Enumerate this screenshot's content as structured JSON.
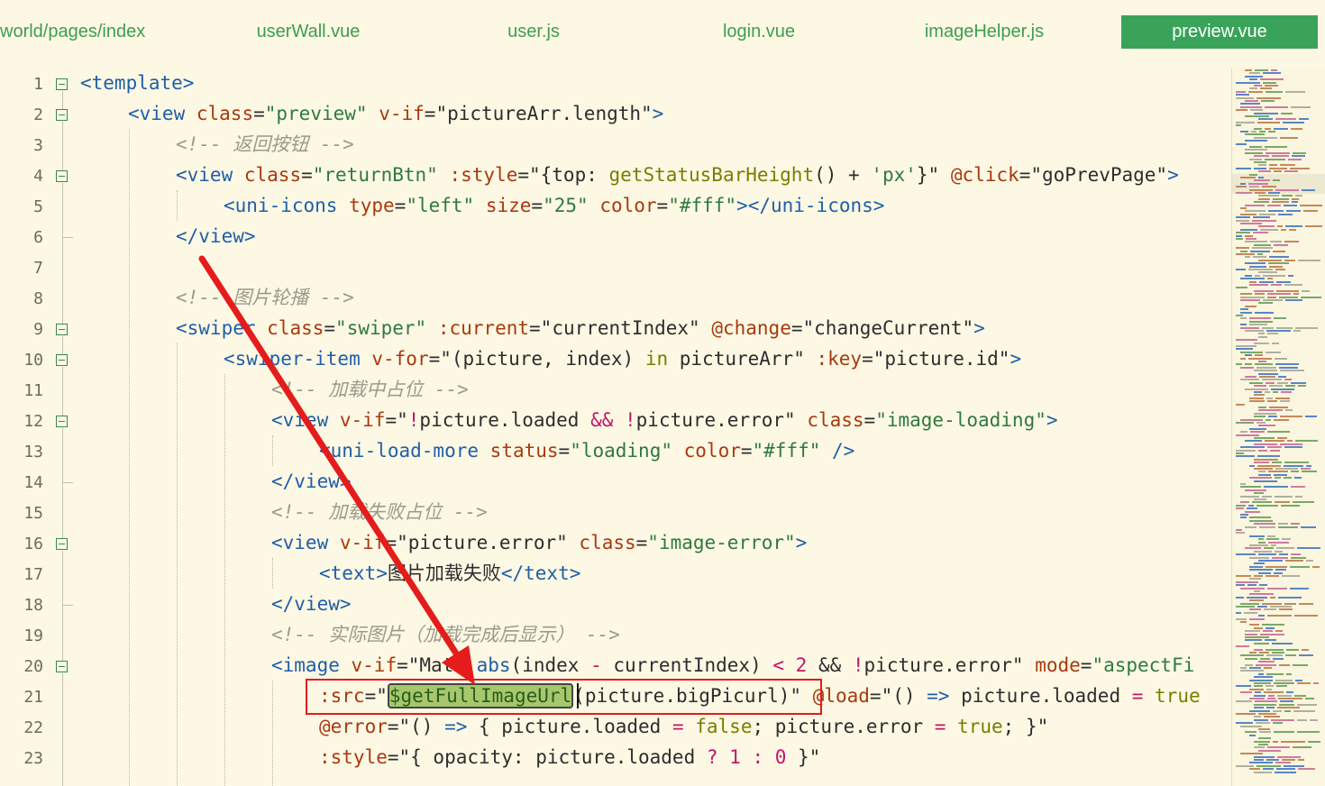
{
  "tabs": [
    {
      "label": "world/pages/index",
      "active": false
    },
    {
      "label": "userWall.vue",
      "active": false
    },
    {
      "label": "user.js",
      "active": false
    },
    {
      "label": "login.vue",
      "active": false
    },
    {
      "label": "imageHelper.js",
      "active": false
    },
    {
      "label": "preview.vue",
      "active": true
    }
  ],
  "line_numbers": [
    "1",
    "2",
    "3",
    "4",
    "5",
    "6",
    "7",
    "8",
    "9",
    "10",
    "11",
    "12",
    "13",
    "14",
    "15",
    "16",
    "17",
    "18",
    "19",
    "20",
    "21",
    "22",
    "23"
  ],
  "code": {
    "l1": {
      "t1": "<template>"
    },
    "l2": {
      "t1": "<view",
      "a1": "class",
      "e1": "=",
      "s1": "\"preview\"",
      "a2": "v-if",
      "e2": "=",
      "s2": "\"pictureArr.length\"",
      "t2": ">"
    },
    "l3": {
      "c1": "<!-- 返回按钮 -->"
    },
    "l4": {
      "t1": "<view",
      "a1": "class",
      "e1": "=",
      "s1": "\"returnBtn\"",
      "a2": ":style",
      "e2": "=",
      "s2": "\"{top: ",
      "f1": "getStatusBarHeight",
      "p1": "() + ",
      "s3": "'px'",
      "s4": "}\"",
      "a3": "@click",
      "e3": "=",
      "s5": "\"goPrevPage\"",
      "t2": ">"
    },
    "l5": {
      "t1": "<uni-icons",
      "a1": "type",
      "e1": "=",
      "s1": "\"left\"",
      "a2": "size",
      "e2": "=",
      "s2": "\"25\"",
      "a3": "color",
      "e3": "=",
      "s3": "\"#fff\"",
      "t2": "></uni-icons>"
    },
    "l6": {
      "t1": "</view>"
    },
    "l8": {
      "c1": "<!-- 图片轮播 -->"
    },
    "l9": {
      "t1": "<swiper",
      "a1": "class",
      "e1": "=",
      "s1": "\"swiper\"",
      "a2": ":current",
      "e2": "=",
      "s2": "\"currentIndex\"",
      "a3": "@change",
      "e3": "=",
      "s3": "\"changeCurrent\"",
      "t2": ">"
    },
    "l10": {
      "t1": "<swiper-item",
      "a1": "v-for",
      "e1": "=",
      "s1": "\"(picture, index) ",
      "k1": "in",
      "s2": " pictureArr\"",
      "a2": ":key",
      "e2": "=",
      "s3": "\"picture.id\"",
      "t2": ">"
    },
    "l11": {
      "c1": "<!-- 加载中占位 -->"
    },
    "l12": {
      "t1": "<view",
      "a1": "v-if",
      "e1": "=",
      "s1": "\"",
      "n1": "!",
      "p1": "picture.loaded ",
      "n2": "&& !",
      "p2": "picture.error\"",
      "a2": "class",
      "e2": "=",
      "s2": "\"image-loading\"",
      "t2": ">"
    },
    "l13": {
      "t1": "<uni-load-more",
      "a1": "status",
      "e1": "=",
      "s1": "\"loading\"",
      "a2": "color",
      "e2": "=",
      "s2": "\"#fff\"",
      "t2": "/>"
    },
    "l14": {
      "t1": "</view>"
    },
    "l15": {
      "c1": "<!-- 加载失败占位 -->"
    },
    "l16": {
      "t1": "<view",
      "a1": "v-if",
      "e1": "=",
      "s1": "\"picture.error\"",
      "a2": "class",
      "e2": "=",
      "s2": "\"image-error\"",
      "t2": ">"
    },
    "l17": {
      "t1": "<text>",
      "p1": "图片加载失败",
      "t2": "</text>"
    },
    "l18": {
      "t1": "</view>"
    },
    "l19": {
      "c1": "<!-- 实际图片（加载完成后显示） -->"
    },
    "l20": {
      "t1": "<image",
      "a1": "v-if",
      "e1": "=",
      "s1": "\"Math.",
      "f1": "abs",
      "p1": "(index ",
      "n1": "-",
      "p2": " currentIndex) ",
      "n2": "< 2",
      "p3": " && ",
      "n3": "!",
      "p4": "picture.error\"",
      "a2": "mode",
      "e2": "=",
      "s2": "\"aspectFi"
    },
    "l21": {
      "a1": ":src",
      "p1": "=\"",
      "hl": "$getFullImageUrl",
      "p2": "(picture.bigPicurl)\"",
      "a2": "@load",
      "p3": "=\"() ",
      "k1": "=>",
      "p4": " picture.loaded ",
      "n1": "=",
      "k2": " true"
    },
    "l22": {
      "a1": "@error",
      "p1": "=\"() ",
      "k1": "=>",
      "p2": " { picture.loaded ",
      "n1": "=",
      "f1": " false",
      "p3": "; picture.error ",
      "n2": "=",
      "f2": " true",
      "p4": "; }\""
    },
    "l23": {
      "a1": ":style",
      "p1": "=\"{ opacity: picture.loaded ",
      "n1": "? 1 : 0",
      "p2": " }\""
    }
  },
  "colors": {
    "background": "#fdf8e4",
    "active_tab": "#3aa35a",
    "annotation_red": "#e41c1c",
    "highlight": "#a6c76c"
  }
}
